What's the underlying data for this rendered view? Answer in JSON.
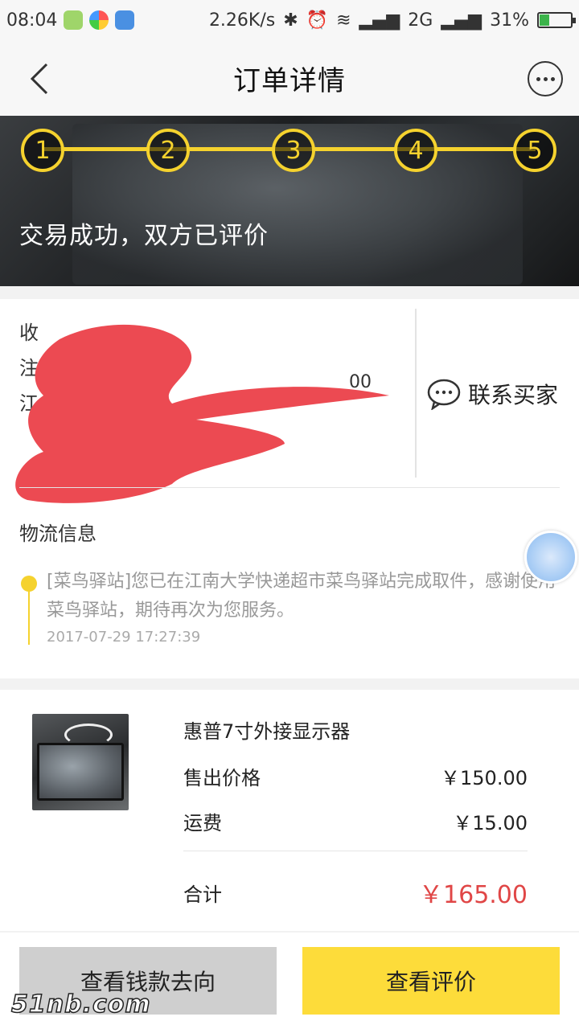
{
  "status_bar": {
    "time": "08:04",
    "speed": "2.26K/s",
    "network": "2G",
    "battery": "31%"
  },
  "nav": {
    "title": "订单详情"
  },
  "banner": {
    "steps": [
      "1",
      "2",
      "3",
      "4",
      "5"
    ],
    "status_text": "交易成功，双方已评价"
  },
  "address": {
    "visible_line1": "收",
    "visible_line2": "注",
    "visible_line3": "江",
    "partial_right": "00",
    "contact_label": "联系买家"
  },
  "logistics": {
    "title": "物流信息",
    "message": "[菜鸟驿站]您已在江南大学快递超市菜鸟驿站完成取件，感谢使用菜鸟驿站，期待再次为您服务。",
    "time": "2017-07-29 17:27:39"
  },
  "order": {
    "product_name": "惠普7寸外接显示器",
    "price_label": "售出价格",
    "price_value": "￥150.00",
    "shipping_label": "运费",
    "shipping_value": "￥15.00",
    "total_label": "合计",
    "total_value": "￥165.00"
  },
  "actions": {
    "money_flow_label": "查看钱款去向",
    "review_label": "查看评价"
  },
  "watermark": "51nb.com",
  "colors": {
    "accent_yellow": "#f5d22e",
    "button_yellow": "#fddc3a",
    "button_gray": "#cfcfcf",
    "total_red": "#e04646",
    "scribble_red": "#ec4a52"
  }
}
